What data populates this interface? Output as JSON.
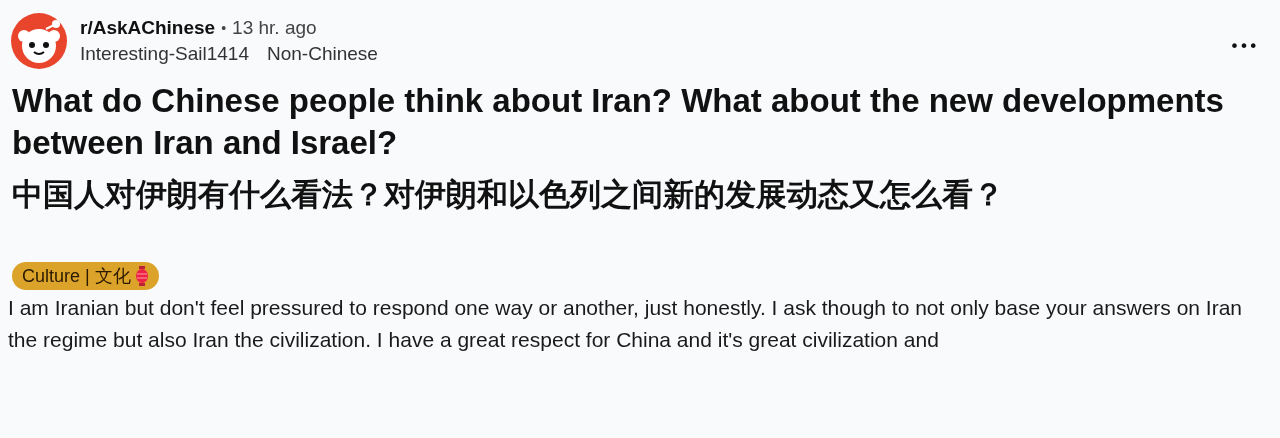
{
  "post": {
    "subreddit": "r/AskAChinese",
    "separator": "•",
    "time": "13 hr. ago",
    "author": "Interesting-Sail1414",
    "user_flair": "Non-Chinese",
    "more_button": "•••",
    "title": "What do Chinese people think about Iran? What about the new developments between Iran and Israel?",
    "title_chinese": "中国人对伊朗有什么看法？对伊朗和以色列之间新的发展动态又怎么看？",
    "flair": "Culture | 文化",
    "body": "I am Iranian but don't feel pressured to respond one way or another, just honestly. I ask though to not only base your answers on Iran the regime but also Iran the civilization. I have a great respect for China and it's great civilization and"
  }
}
